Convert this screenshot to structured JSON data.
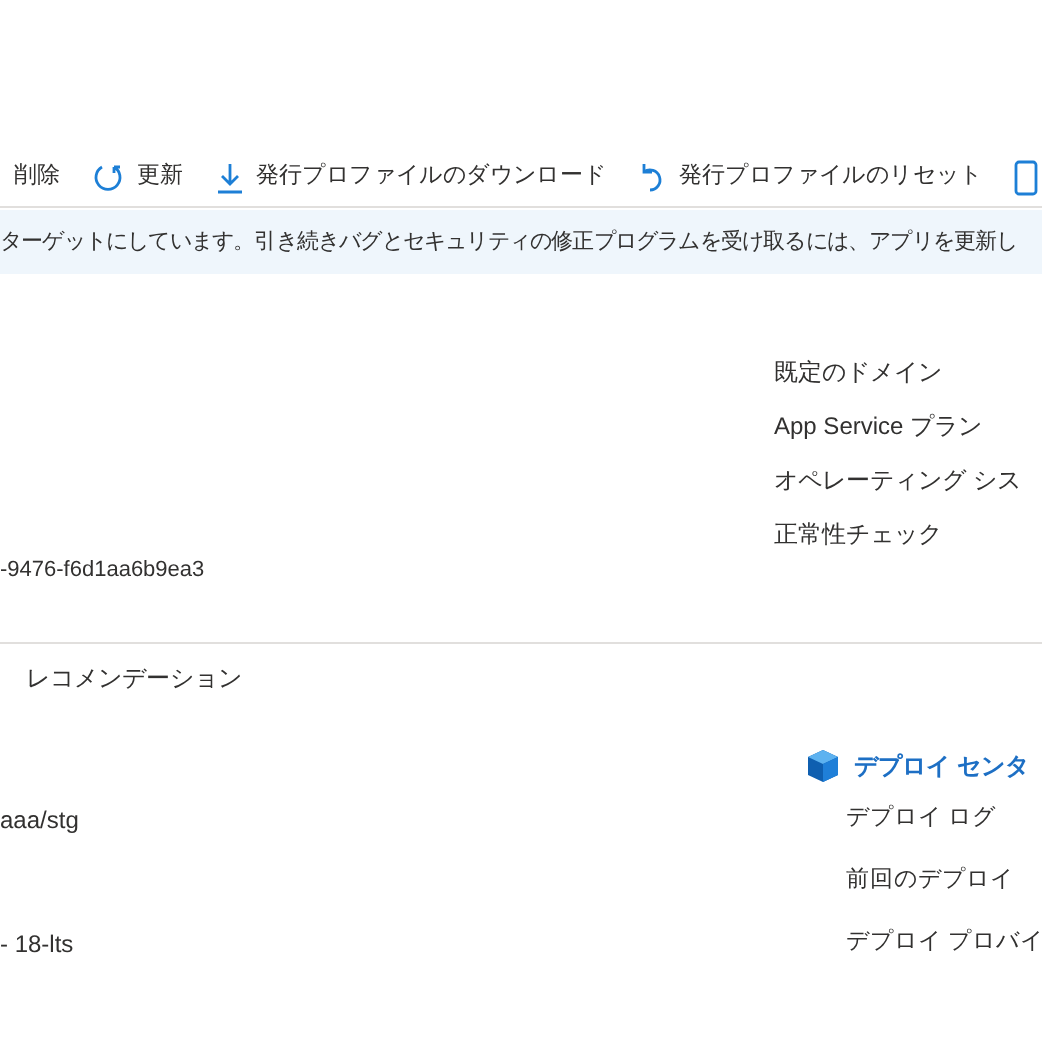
{
  "toolbar": [
    {
      "kind": "text",
      "label": "削除"
    },
    {
      "kind": "refresh",
      "label": "更新"
    },
    {
      "kind": "download",
      "label": "発行プロファイルのダウンロード"
    },
    {
      "kind": "undo",
      "label": "発行プロファイルのリセット"
    },
    {
      "kind": "device"
    }
  ],
  "banner": {
    "text": "ターゲットにしています。引き続きバグとセキュリティの修正プログラムを受け取るには、アプリを更新し"
  },
  "essentials": {
    "left_values": [
      "-9476-f6d1aa6b9ea3"
    ],
    "right_labels": [
      "既定のドメイン",
      "App Service プラン",
      "オペレーティング シス",
      "正常性チェック"
    ]
  },
  "tab": {
    "label": "レコメンデーション"
  },
  "deploy": {
    "left_values": [
      "aaa/stg",
      "- 18-lts"
    ],
    "heading": "デプロイ センタ",
    "links": [
      "デプロイ ログ",
      "前回のデプロイ",
      "デプロイ プロバイ"
    ]
  }
}
